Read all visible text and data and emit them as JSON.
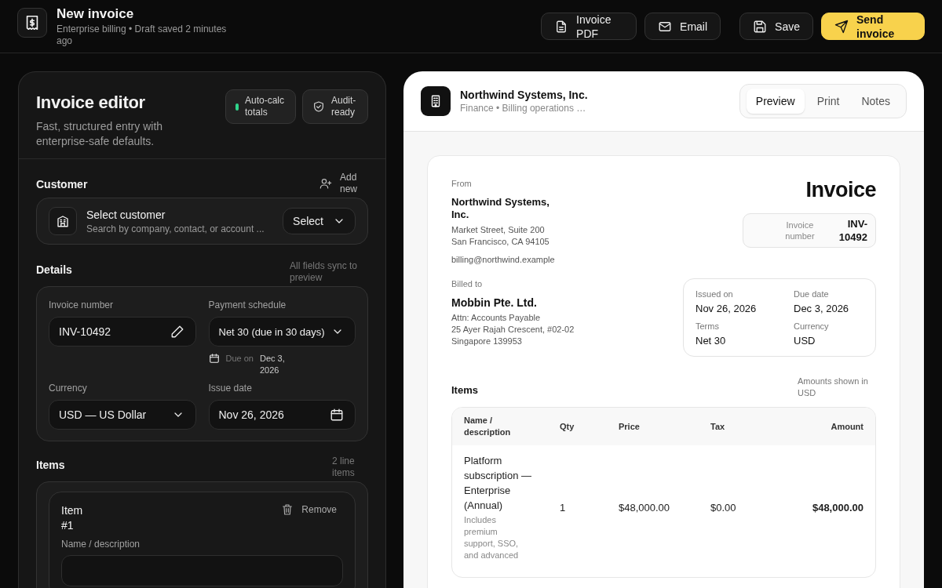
{
  "header": {
    "title": "New invoice",
    "subtitle": "Enterprise billing • Draft saved 2 minutes ago",
    "actions": [
      {
        "kind": "pdf",
        "label": "Invoice PDF",
        "primary": false
      },
      {
        "kind": "email",
        "label": "Email",
        "primary": false
      },
      {
        "kind": "save",
        "label": "Save",
        "primary": false
      },
      {
        "kind": "send",
        "label": "Send invoice",
        "primary": true
      }
    ]
  },
  "editor": {
    "title": "Invoice editor",
    "subtitle": "Fast, structured entry with enterprise-safe defaults.",
    "chips": [
      {
        "kind": "status",
        "label": "Auto-calc totals"
      },
      {
        "kind": "verified",
        "label": "Audit-ready"
      }
    ],
    "customer": {
      "heading": "Customer",
      "add_label": "Add new",
      "title": "Select customer",
      "hint": "Search by company, contact, or account ...",
      "select_label": "Select"
    },
    "details": {
      "heading": "Details",
      "note": "All fields sync to preview",
      "invoice_number": {
        "label": "Invoice number",
        "value": "INV-10492"
      },
      "payment_schedule": {
        "label": "Payment schedule",
        "value": "Net 30 (due in 30 days)",
        "due_label": "Due on",
        "due_value": "Dec 3, 2026"
      },
      "currency": {
        "label": "Currency",
        "value": "USD — US Dollar"
      },
      "issue_date": {
        "label": "Issue date",
        "value": "Nov 26, 2026"
      }
    },
    "items": {
      "heading": "Items",
      "note": "2 line items",
      "item_title": "Item #1",
      "remove_label": "Remove",
      "name_label": "Name / description"
    }
  },
  "preview": {
    "company": "Northwind Systems, Inc.",
    "company_subtitle": "Finance • Billing operations …",
    "tabs": [
      {
        "label": "Preview",
        "selected": true
      },
      {
        "label": "Print",
        "selected": false
      },
      {
        "label": "Notes",
        "selected": false
      }
    ],
    "document": {
      "title": "Invoice",
      "from_label": "From",
      "from_name": "Northwind Systems, Inc.",
      "from_address": [
        "Market Street, Suite 200",
        "San Francisco, CA 94105"
      ],
      "from_email": "billing@northwind.example",
      "number_label": "Invoice number",
      "number_value": "INV-10492",
      "billed_label": "Billed to",
      "billed_name": "Mobbin Pte. Ltd.",
      "billed_address": [
        "Attn: Accounts Payable",
        "25 Ayer Rajah Crescent, #02-02",
        "Singapore 139953"
      ],
      "facts": [
        {
          "label": "Issued on",
          "value": "Nov 26, 2026"
        },
        {
          "label": "Due date",
          "value": "Dec 3, 2026"
        },
        {
          "label": "Terms",
          "value": "Net 30"
        },
        {
          "label": "Currency",
          "value": "USD"
        }
      ],
      "items_heading": "Items",
      "items_note": "Amounts shown in USD",
      "columns": [
        "Name / description",
        "Qty",
        "Price",
        "Tax",
        "Amount"
      ],
      "rows": [
        {
          "name": "Platform subscription — Enterprise (Annual)",
          "description": "Includes premium support, SSO, and advanced",
          "qty": "1",
          "price": "$48,000.00",
          "tax": "$0.00",
          "amount": "$48,000.00"
        }
      ]
    }
  }
}
